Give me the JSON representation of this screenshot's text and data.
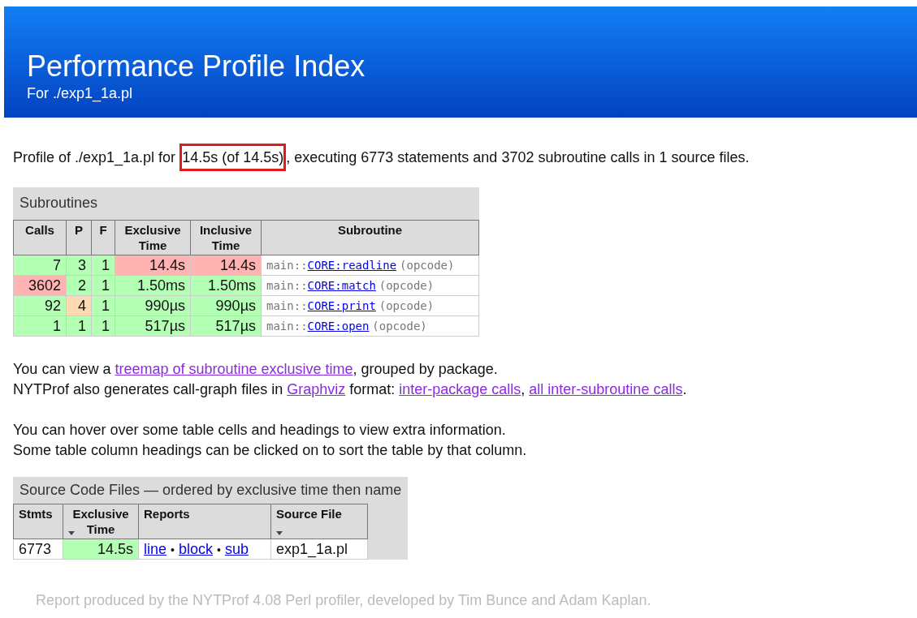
{
  "header": {
    "title": "Performance Profile Index",
    "subtitle": "For ./exp1_1a.pl"
  },
  "summary": {
    "before": "Profile of ./exp1_1a.pl for ",
    "highlight": "14.5s (of 14.5s)",
    "after": ", executing 6773 statements and 3702 subroutine calls in 1 source files."
  },
  "subroutines": {
    "caption": "Subroutines",
    "columns": [
      "Calls",
      "P",
      "F",
      "Exclusive Time",
      "Inclusive Time",
      "Subroutine"
    ],
    "rows": [
      {
        "cells": [
          {
            "text": "7",
            "color": "#b3ffb3"
          },
          {
            "text": "3",
            "color": "#b3ffb3"
          },
          {
            "text": "1",
            "color": "#b3ffb3"
          },
          {
            "text": "14.4s",
            "color": "#ffb3b3"
          },
          {
            "text": "14.4s",
            "color": "#ffb3b3"
          }
        ],
        "package": "main::",
        "link": "CORE:readline",
        "note": "(opcode)"
      },
      {
        "cells": [
          {
            "text": "3602",
            "color": "#ffb3b3"
          },
          {
            "text": "2",
            "color": "#b3ffb3"
          },
          {
            "text": "1",
            "color": "#b3ffb3"
          },
          {
            "text": "1.50ms",
            "color": "#b3ffb3"
          },
          {
            "text": "1.50ms",
            "color": "#b3ffb3"
          }
        ],
        "package": "main::",
        "link": "CORE:match",
        "note": "(opcode)"
      },
      {
        "cells": [
          {
            "text": "92",
            "color": "#b3ffb3"
          },
          {
            "text": "4",
            "color": "#ffd9b3"
          },
          {
            "text": "1",
            "color": "#b3ffb3"
          },
          {
            "text": "990µs",
            "color": "#b3ffb3"
          },
          {
            "text": "990µs",
            "color": "#b3ffb3"
          }
        ],
        "package": "main::",
        "link": "CORE:print",
        "note": "(opcode)"
      },
      {
        "cells": [
          {
            "text": "1",
            "color": "#b3ffb3"
          },
          {
            "text": "1",
            "color": "#b3ffb3"
          },
          {
            "text": "1",
            "color": "#b3ffb3"
          },
          {
            "text": "517µs",
            "color": "#b3ffb3"
          },
          {
            "text": "517µs",
            "color": "#b3ffb3"
          }
        ],
        "package": "main::",
        "link": "CORE:open",
        "note": "(opcode)"
      }
    ]
  },
  "paragraphs": [
    [
      {
        "kind": "text",
        "text": "You can view a "
      },
      {
        "kind": "link",
        "text": "treemap of subroutine exclusive time",
        "visited": true
      },
      {
        "kind": "text",
        "text": ", grouped by package."
      }
    ],
    [
      {
        "kind": "text",
        "text": "NYTProf also generates call-graph files in "
      },
      {
        "kind": "link",
        "text": "Graphviz",
        "visited": true
      },
      {
        "kind": "text",
        "text": " format: "
      },
      {
        "kind": "link",
        "text": "inter-package calls",
        "visited": true
      },
      {
        "kind": "text",
        "text": ", "
      },
      {
        "kind": "link",
        "text": "all inter-subroutine calls",
        "visited": true
      },
      {
        "kind": "text",
        "text": "."
      }
    ],
    [
      {
        "kind": "break"
      }
    ],
    [
      {
        "kind": "text",
        "text": "You can hover over some table cells and headings to view extra information."
      }
    ],
    [
      {
        "kind": "text",
        "text": "Some table column headings can be clicked on to sort the table by that column."
      }
    ]
  ],
  "files": {
    "caption": "Source Code Files — ordered by exclusive time then name",
    "columns": [
      {
        "label": "Stmts",
        "sorted": false
      },
      {
        "label": "Exclusive Time",
        "sorted": true
      },
      {
        "label": "Reports",
        "sorted": false
      },
      {
        "label": "Source File",
        "sorted": true
      }
    ],
    "rows": [
      {
        "stmts": "6773",
        "time": {
          "text": "14.5s",
          "color": "#b3ffb3"
        },
        "reports": [
          "line",
          "block",
          "sub"
        ],
        "separator": "•",
        "file": "exp1_1a.pl"
      }
    ]
  },
  "footer": "Report produced by the NYTProf 4.08 Perl profiler, developed by Tim Bunce and Adam Kaplan."
}
